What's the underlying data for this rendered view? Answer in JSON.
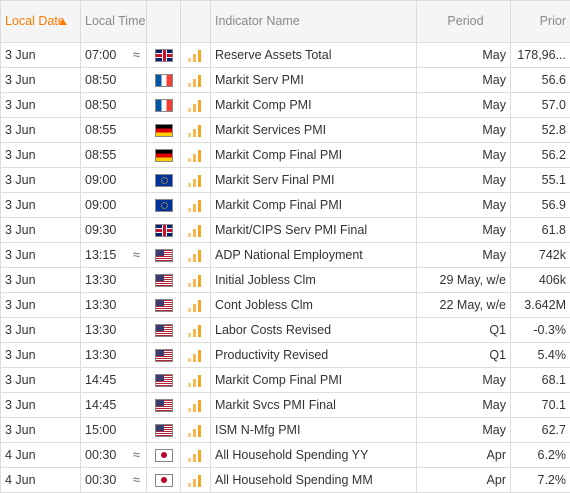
{
  "columns": {
    "date": "Local Date",
    "time": "Local Time",
    "name": "Indicator Name",
    "period": "Period",
    "prior": "Prior"
  },
  "colors": {
    "accent": "#ff7a00",
    "importance": "#f5a623"
  },
  "rows": [
    {
      "date": "3 Jun",
      "time": "07:00",
      "approx": "≈",
      "flag": "uk-flag-icon",
      "name": "Reserve Assets Total",
      "period": "May",
      "prior": "178,96..."
    },
    {
      "date": "3 Jun",
      "time": "08:50",
      "approx": "",
      "flag": "fr-flag-icon",
      "name": "Markit Serv PMI",
      "period": "May",
      "prior": "56.6"
    },
    {
      "date": "3 Jun",
      "time": "08:50",
      "approx": "",
      "flag": "fr-flag-icon",
      "name": "Markit Comp PMI",
      "period": "May",
      "prior": "57.0"
    },
    {
      "date": "3 Jun",
      "time": "08:55",
      "approx": "",
      "flag": "de-flag-icon",
      "name": "Markit Services PMI",
      "period": "May",
      "prior": "52.8"
    },
    {
      "date": "3 Jun",
      "time": "08:55",
      "approx": "",
      "flag": "de-flag-icon",
      "name": "Markit Comp Final PMI",
      "period": "May",
      "prior": "56.2"
    },
    {
      "date": "3 Jun",
      "time": "09:00",
      "approx": "",
      "flag": "eu-flag-icon",
      "name": "Markit Serv Final PMI",
      "period": "May",
      "prior": "55.1"
    },
    {
      "date": "3 Jun",
      "time": "09:00",
      "approx": "",
      "flag": "eu-flag-icon",
      "name": "Markit Comp Final PMI",
      "period": "May",
      "prior": "56.9"
    },
    {
      "date": "3 Jun",
      "time": "09:30",
      "approx": "",
      "flag": "uk-flag-icon",
      "name": "Markit/CIPS Serv PMI Final",
      "period": "May",
      "prior": "61.8"
    },
    {
      "date": "3 Jun",
      "time": "13:15",
      "approx": "≈",
      "flag": "us-flag-icon",
      "name": "ADP National Employment",
      "period": "May",
      "prior": "742k"
    },
    {
      "date": "3 Jun",
      "time": "13:30",
      "approx": "",
      "flag": "us-flag-icon",
      "name": "Initial Jobless Clm",
      "period": "29 May, w/e",
      "prior": "406k"
    },
    {
      "date": "3 Jun",
      "time": "13:30",
      "approx": "",
      "flag": "us-flag-icon",
      "name": "Cont Jobless Clm",
      "period": "22 May, w/e",
      "prior": "3.642M"
    },
    {
      "date": "3 Jun",
      "time": "13:30",
      "approx": "",
      "flag": "us-flag-icon",
      "name": "Labor Costs Revised",
      "period": "Q1",
      "prior": "-0.3%"
    },
    {
      "date": "3 Jun",
      "time": "13:30",
      "approx": "",
      "flag": "us-flag-icon",
      "name": "Productivity Revised",
      "period": "Q1",
      "prior": "5.4%"
    },
    {
      "date": "3 Jun",
      "time": "14:45",
      "approx": "",
      "flag": "us-flag-icon",
      "name": "Markit Comp Final PMI",
      "period": "May",
      "prior": "68.1"
    },
    {
      "date": "3 Jun",
      "time": "14:45",
      "approx": "",
      "flag": "us-flag-icon",
      "name": "Markit Svcs PMI Final",
      "period": "May",
      "prior": "70.1"
    },
    {
      "date": "3 Jun",
      "time": "15:00",
      "approx": "",
      "flag": "us-flag-icon",
      "name": "ISM N-Mfg PMI",
      "period": "May",
      "prior": "62.7"
    },
    {
      "date": "4 Jun",
      "time": "00:30",
      "approx": "≈",
      "flag": "jp-flag-icon",
      "name": "All Household Spending YY",
      "period": "Apr",
      "prior": "6.2%"
    },
    {
      "date": "4 Jun",
      "time": "00:30",
      "approx": "≈",
      "flag": "jp-flag-icon",
      "name": "All Household Spending MM",
      "period": "Apr",
      "prior": "7.2%"
    }
  ]
}
